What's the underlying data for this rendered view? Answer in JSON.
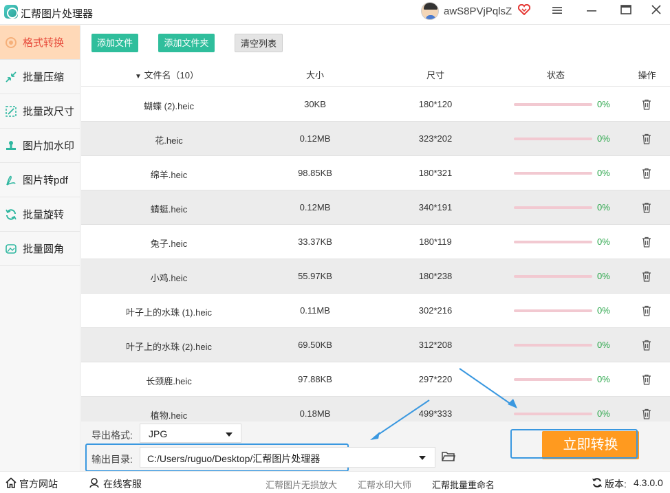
{
  "app": {
    "title": "汇帮图片处理器",
    "username": "awS8PVjPqlsZ",
    "window_controls": [
      "menu-icon",
      "minimize-icon",
      "maximize-icon",
      "close-icon"
    ]
  },
  "sidebar": {
    "items": [
      {
        "label": "格式转换",
        "icon": "convert-icon",
        "active": true
      },
      {
        "label": "批量压缩",
        "icon": "compress-icon",
        "active": false
      },
      {
        "label": "批量改尺寸",
        "icon": "resize-icon",
        "active": false
      },
      {
        "label": "图片加水印",
        "icon": "watermark-icon",
        "active": false
      },
      {
        "label": "图片转pdf",
        "icon": "pdf-icon",
        "active": false
      },
      {
        "label": "批量旋转",
        "icon": "rotate-icon",
        "active": false
      },
      {
        "label": "批量圆角",
        "icon": "round-corner-icon",
        "active": false
      }
    ]
  },
  "toolbar": {
    "add_file": "添加文件",
    "add_folder": "添加文件夹",
    "clear_list": "清空列表"
  },
  "table": {
    "headers": {
      "name": "文件名（10）",
      "size": "大小",
      "dimensions": "尺寸",
      "status": "状态",
      "action": "操作"
    },
    "rows": [
      {
        "name": "蝴蝶 (2).heic",
        "size": "30KB",
        "dimensions": "180*120",
        "progress": "0%"
      },
      {
        "name": "花.heic",
        "size": "0.12MB",
        "dimensions": "323*202",
        "progress": "0%"
      },
      {
        "name": "绵羊.heic",
        "size": "98.85KB",
        "dimensions": "180*321",
        "progress": "0%"
      },
      {
        "name": "蜻蜓.heic",
        "size": "0.12MB",
        "dimensions": "340*191",
        "progress": "0%"
      },
      {
        "name": "兔子.heic",
        "size": "33.37KB",
        "dimensions": "180*119",
        "progress": "0%"
      },
      {
        "name": "小鸡.heic",
        "size": "55.97KB",
        "dimensions": "180*238",
        "progress": "0%"
      },
      {
        "name": "叶子上的水珠 (1).heic",
        "size": "0.11MB",
        "dimensions": "302*216",
        "progress": "0%"
      },
      {
        "name": "叶子上的水珠 (2).heic",
        "size": "69.50KB",
        "dimensions": "312*208",
        "progress": "0%"
      },
      {
        "name": "长颈鹿.heic",
        "size": "97.88KB",
        "dimensions": "297*220",
        "progress": "0%"
      },
      {
        "name": "植物.heic",
        "size": "0.18MB",
        "dimensions": "499*333",
        "progress": "0%"
      }
    ]
  },
  "settings": {
    "format_label": "导出格式:",
    "format_value": "JPG",
    "output_label": "输出目录:",
    "output_value": "C:/Users/ruguo/Desktop/汇帮图片处理器",
    "convert_button": "立即转换"
  },
  "footer": {
    "website": "官方网站",
    "support": "在线客服",
    "links": [
      "汇帮图片无损放大",
      "汇帮水印大师",
      "汇帮批量重命名"
    ],
    "version_label": "版本:",
    "version_value": "4.3.0.0"
  },
  "colors": {
    "accent_green": "#2fbe9c",
    "active_tab_bg": "#ffd9b8",
    "active_tab_text": "#e74c3c",
    "convert_orange": "#ff9a1f",
    "highlight_blue": "#3a98e0",
    "progress_track": "#f2c9d1",
    "percent_green": "#2aa64a"
  }
}
